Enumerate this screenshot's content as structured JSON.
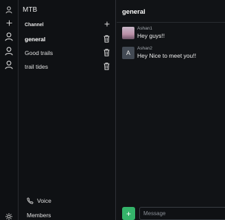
{
  "rail": {
    "icons": [
      "user-icon",
      "plus-icon",
      "user-icon",
      "user-icon",
      "user-icon"
    ],
    "bottom_icon": "sun-settings-icon"
  },
  "server": {
    "title": "MTB",
    "section_label": "Channel",
    "channels": [
      {
        "label": "general",
        "active": true
      },
      {
        "label": "Good trails",
        "active": false
      },
      {
        "label": "trail tides",
        "active": false
      }
    ],
    "voice_label": "Voice",
    "members_label": "Members"
  },
  "chat": {
    "title": "general",
    "messages": [
      {
        "author": "Ashan1",
        "text": "Hey guys!!",
        "avatar": "image"
      },
      {
        "author": "Ashan2",
        "text": "Hey Nice to meet you!!",
        "avatar_letter": "A"
      }
    ],
    "compose": {
      "plus_label": "+",
      "placeholder": "Message"
    }
  },
  "colors": {
    "accent": "#34b46a",
    "background": "#121417"
  }
}
